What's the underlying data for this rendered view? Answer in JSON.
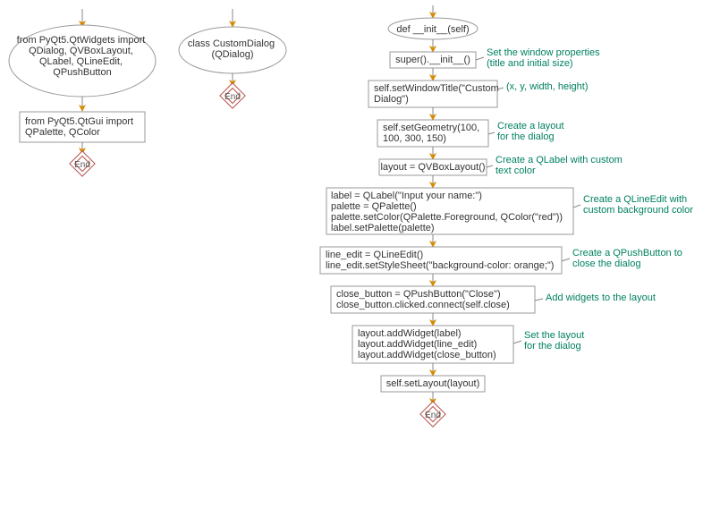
{
  "col1": {
    "ellipse": "from PyQt5.QtWidgets import\nQDialog, QVBoxLayout,\nQLabel, QLineEdit,\nQPushButton",
    "box": "from PyQt5.QtGui import\nQPalette, QColor",
    "end": "End"
  },
  "col2": {
    "ellipse": "class CustomDialog\n(QDialog)",
    "end": "End"
  },
  "col3": {
    "n1": "def __init__(self)",
    "n2": "super().__init__()",
    "c2": "Set the window properties\n(title and initial size)",
    "n3": "self.setWindowTitle(\"Custom\nDialog\")",
    "c3": "(x, y, width, height)",
    "n4": "self.setGeometry(100,\n100, 300, 150)",
    "c4": "Create a layout\nfor the dialog",
    "n5": "layout = QVBoxLayout()",
    "c5": "Create a QLabel with custom\ntext color",
    "n6": "label = QLabel(\"Input your name:\")\npalette = QPalette()\npalette.setColor(QPalette.Foreground, QColor(\"red\"))\nlabel.setPalette(palette)",
    "c6": "Create a QLineEdit with\ncustom background color",
    "n7": "line_edit = QLineEdit()\nline_edit.setStyleSheet(\"background-color: orange;\")",
    "c7": "Create a QPushButton to\nclose the dialog",
    "n8": "close_button = QPushButton(\"Close\")\nclose_button.clicked.connect(self.close)",
    "c8": "Add widgets to the layout",
    "n9": "layout.addWidget(label)\nlayout.addWidget(line_edit)\nlayout.addWidget(close_button)",
    "c9": "Set the layout\nfor the dialog",
    "n10": "self.setLayout(layout)",
    "end": "End"
  }
}
